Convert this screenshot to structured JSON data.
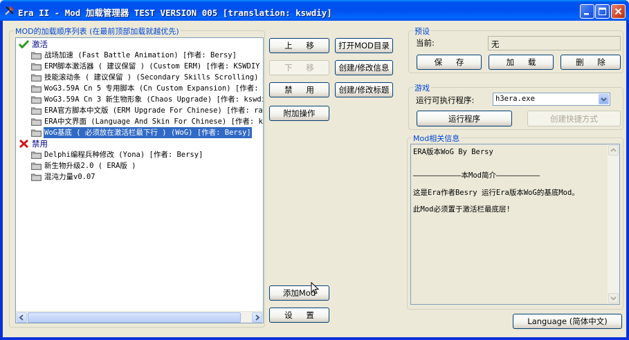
{
  "window": {
    "title": "Era II - Mod 加载管理器 TEST VERSION 005 [translation: kswdiy]"
  },
  "mod_list": {
    "group_label": "MOD的加载顺序列表 (在最前顶部加载就越优先)",
    "active_label": "激活",
    "disabled_label": "禁用",
    "active_items": [
      "战场加速 (Fast Battle Animation) [作者: Bersy]",
      "ERM脚本激活器 ( 建议保留 ) (Custom ERM) [作者: KSWDIY",
      "技能滚动条 ( 建议保留 ) (Secondary Skills Scrolling)",
      "WoG3.59A Cn 5 专用脚本 (Cn Custom Expansion) [作者: k",
      "WoG3.59A Cn 3 新生物形象 (Chaos Upgrade) [作者: kswdi",
      "ERA官方脚本中文版 (ERM Upgrade For Chinese) [作者: ra",
      "ERA中文界面 (Language And Skin For Chinese) [作者: ks",
      "WoG基底 ( 必须放在激活栏最下行 ) (WoG) [作者: Bersy]"
    ],
    "selected_index": 7,
    "disabled_items": [
      "Delphi编程兵种修改 (Yona) [作者: Bersy]",
      "新生物升级2.0 ( ERA版 )",
      "混沌力量v0.07"
    ]
  },
  "actions": {
    "move_up": "上 移",
    "move_down": "下 移",
    "disable": "禁 用",
    "extra_ops": "附加操作",
    "open_dir": "打开MOD目录",
    "edit_info": "创建/修改信息",
    "edit_title": "创建/修改标题",
    "add_mod": "添加Mod",
    "settings": "设 置"
  },
  "preset": {
    "group_label": "预设",
    "current_label": "当前:",
    "current_value": "无",
    "save": "保 存",
    "load": "加 载",
    "delete": "删 除"
  },
  "game": {
    "group_label": "游戏",
    "exe_label": "运行可执行程序:",
    "exe_value": "h3era.exe",
    "run": "运行程序",
    "shortcut": "创建快捷方式"
  },
  "mod_info": {
    "group_label": "Mod相关信息",
    "lines": [
      "ERA版本WoG By Bersy",
      "———————————本Mod简介——————————",
      "    这是Era作者Besry 运行Era版本WoG的基底Mod。",
      "    此Mod必须置于激活栏最底层!"
    ]
  },
  "language_button": "Language (简体中文)",
  "colors": {
    "accent": "#0046d5",
    "selection": "#316ac5",
    "titlebar": "#0054e3"
  }
}
